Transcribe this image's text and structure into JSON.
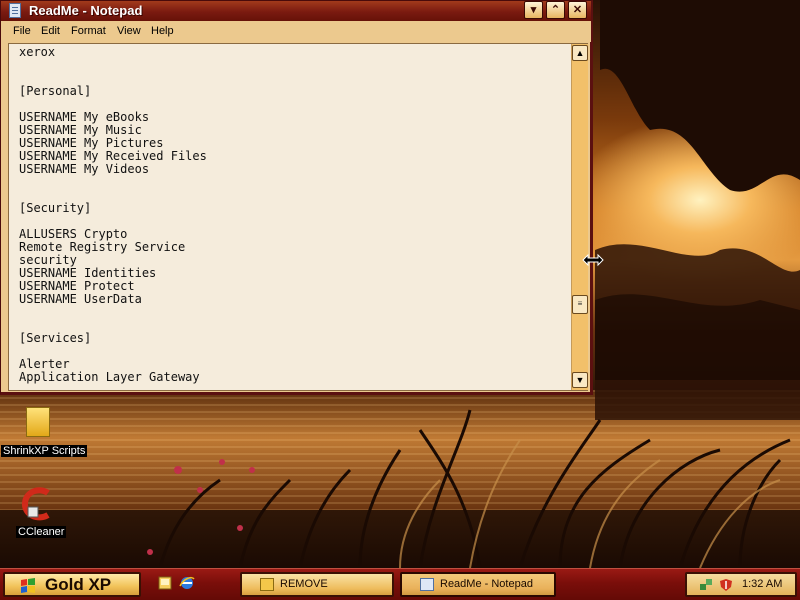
{
  "window": {
    "title": "ReadMe - Notepad",
    "buttons": {
      "minimize": "▾",
      "maximize": "⌃",
      "close": "✕"
    },
    "menu": [
      "File",
      "Edit",
      "Format",
      "View",
      "Help"
    ]
  },
  "document": {
    "lines": [
      "xerox",
      "",
      "",
      "[Personal]",
      "",
      "USERNAME My eBooks",
      "USERNAME My Music",
      "USERNAME My Pictures",
      "USERNAME My Received Files",
      "USERNAME My Videos",
      "",
      "",
      "[Security]",
      "",
      "ALLUSERS Crypto",
      "Remote Registry Service",
      "security",
      "USERNAME Identities",
      "USERNAME Protect",
      "USERNAME UserData",
      "",
      "",
      "[Services]",
      "",
      "Alerter",
      "Application Layer Gateway"
    ]
  },
  "scrollbar": {
    "up": "▲",
    "down": "▼",
    "thumb": "≡"
  },
  "desktop_icons": {
    "scripts_label": "ShrinkXP Scripts",
    "ccleaner_label": "CCleaner"
  },
  "taskbar": {
    "start_label": "Gold XP",
    "tasks": [
      {
        "label": "REMOVE",
        "icon": "folder-icon"
      },
      {
        "label": "ReadMe - Notepad",
        "icon": "notepad-icon"
      }
    ],
    "clock": "1:32 AM"
  },
  "colors": {
    "title_bar": "#7a1a10",
    "window_face": "#ecc98e",
    "taskbar": "#7a0e0a",
    "text_area": "#f5ecdc"
  }
}
